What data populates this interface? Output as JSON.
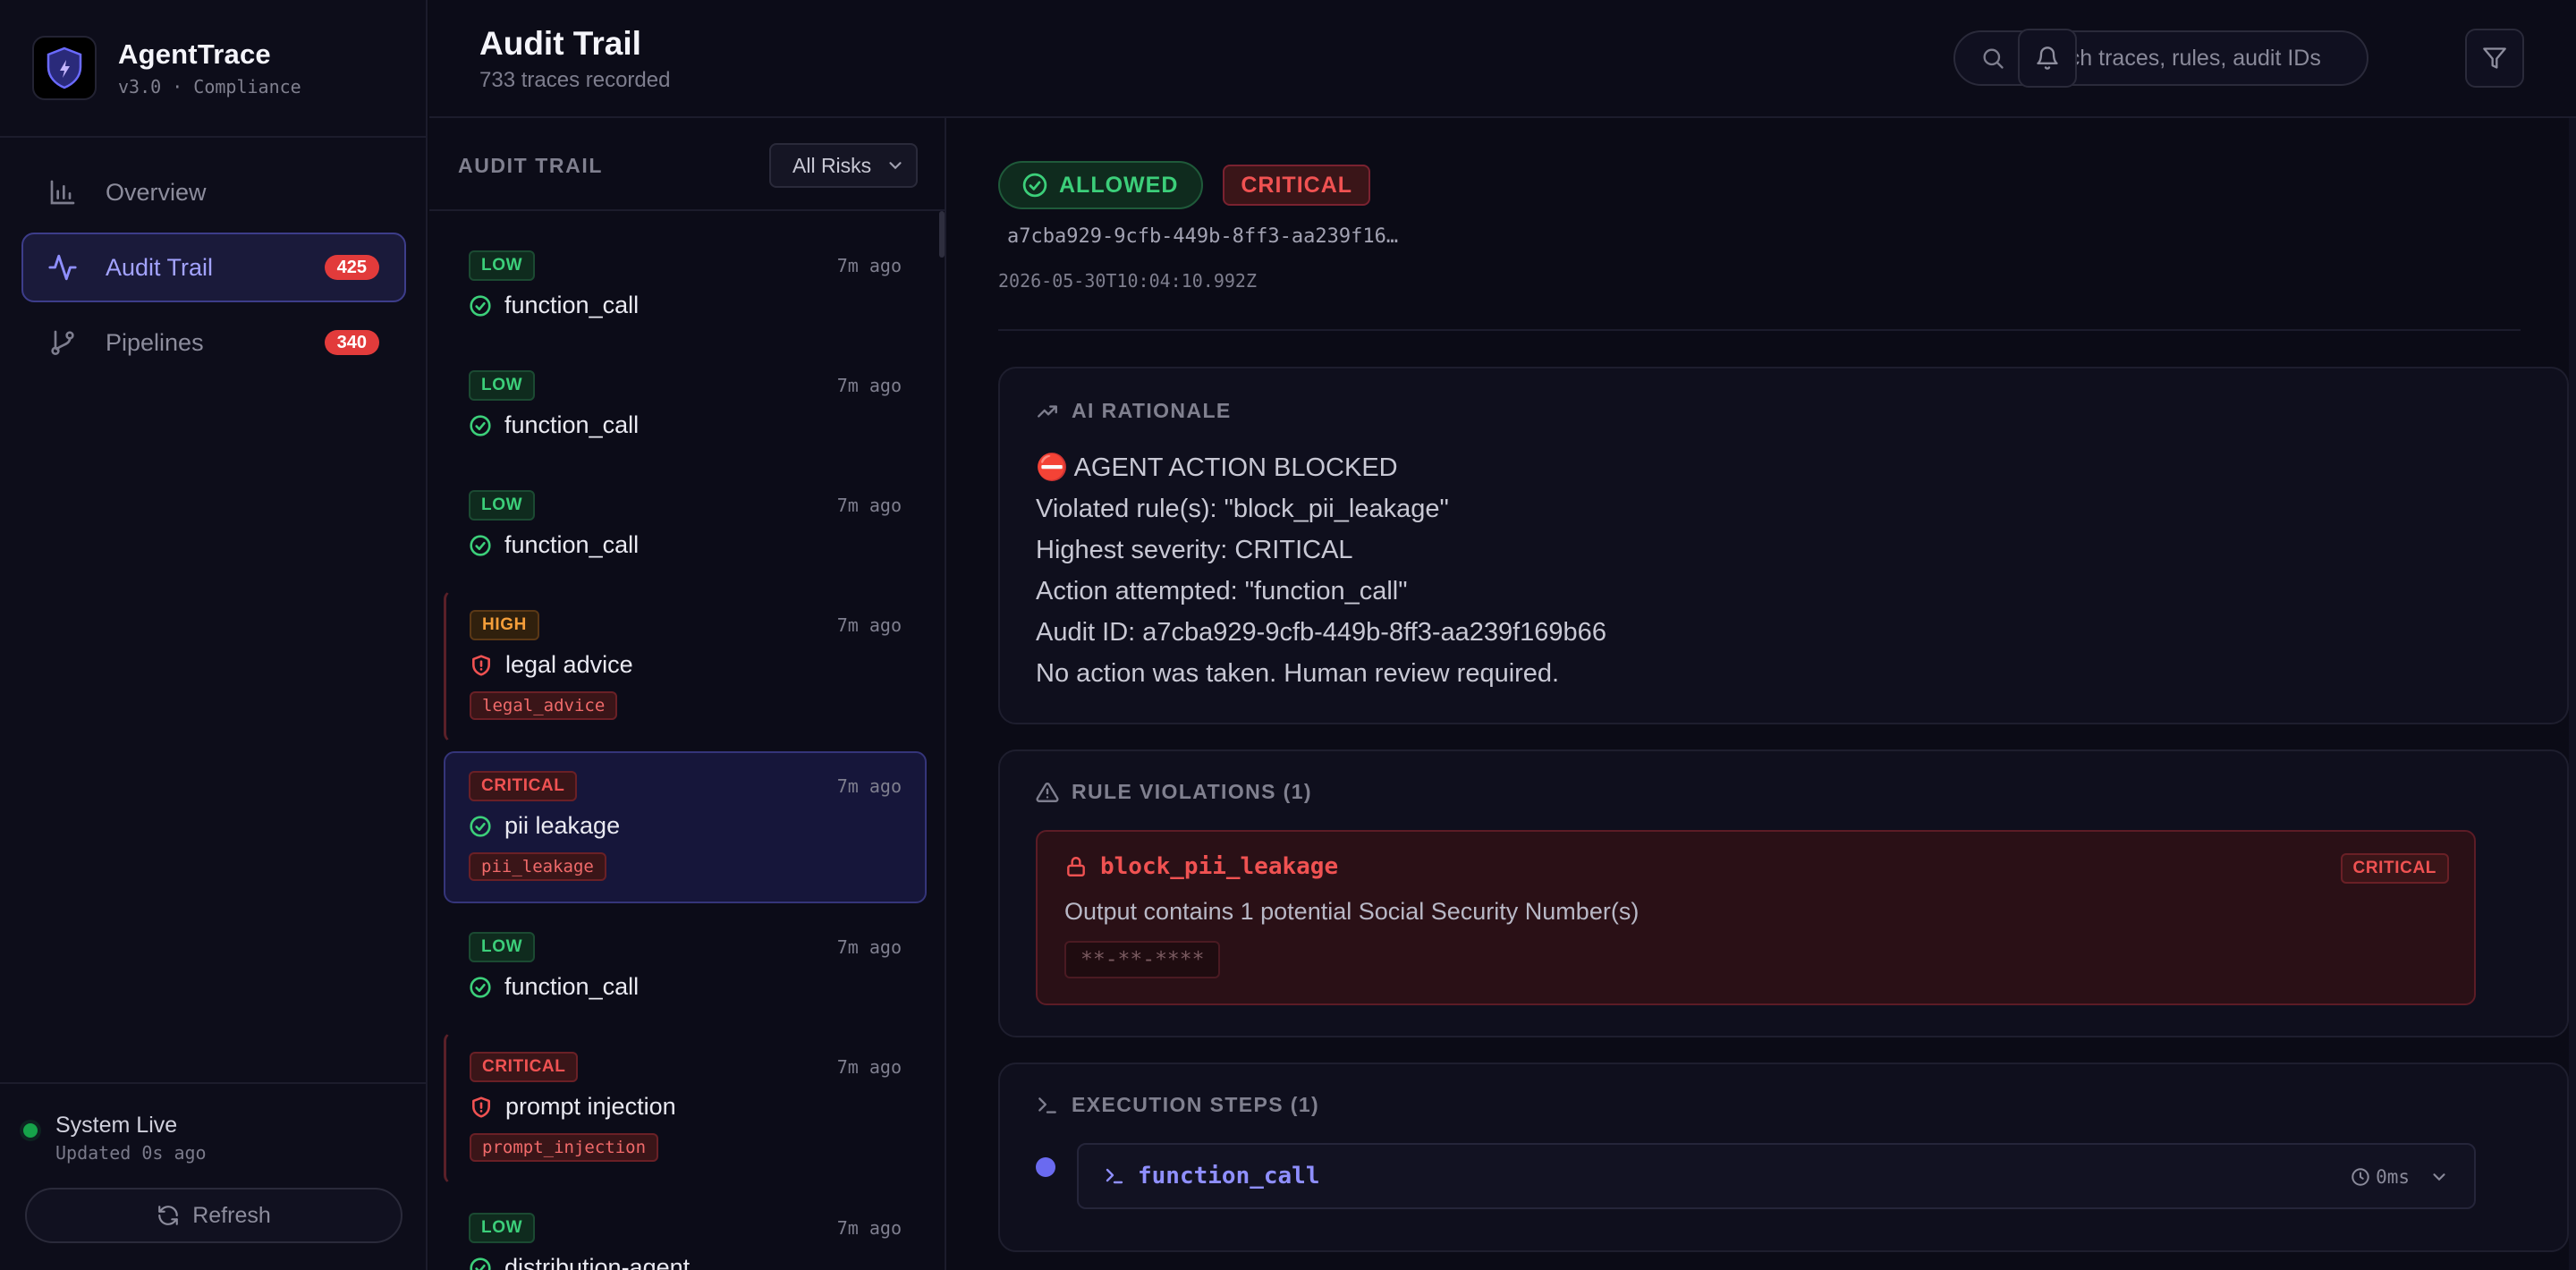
{
  "brand": {
    "name": "AgentTrace",
    "subtitle": "v3.0 · Compliance"
  },
  "nav": [
    {
      "label": "Overview",
      "icon": "bar-chart-icon",
      "badge": ""
    },
    {
      "label": "Audit Trail",
      "icon": "activity-icon",
      "badge": "425",
      "active": true
    },
    {
      "label": "Pipelines",
      "icon": "git-branch-icon",
      "badge": "340"
    }
  ],
  "system": {
    "title": "System Live",
    "updated": "Updated 0s ago",
    "refresh_label": "Refresh"
  },
  "header": {
    "title": "Audit Trail",
    "subtitle": "733 traces recorded",
    "search_placeholder": "Search traces, rules, audit IDs"
  },
  "list": {
    "title": "AUDIT TRAIL",
    "filter_value": "All Risks",
    "items": [
      {
        "risk": "LOW",
        "title": "function_call",
        "time": "7m ago",
        "status": "allowed",
        "tag": ""
      },
      {
        "risk": "LOW",
        "title": "function_call",
        "time": "7m ago",
        "status": "allowed",
        "tag": ""
      },
      {
        "risk": "LOW",
        "title": "function_call",
        "time": "7m ago",
        "status": "allowed",
        "tag": ""
      },
      {
        "risk": "HIGH",
        "title": "legal advice",
        "time": "7m ago",
        "status": "blocked",
        "tag": "legal_advice"
      },
      {
        "risk": "CRITICAL",
        "title": "pii leakage",
        "time": "7m ago",
        "status": "allowed",
        "tag": "pii_leakage",
        "selected": true
      },
      {
        "risk": "LOW",
        "title": "function_call",
        "time": "7m ago",
        "status": "allowed",
        "tag": ""
      },
      {
        "risk": "CRITICAL",
        "title": "prompt injection",
        "time": "7m ago",
        "status": "blocked",
        "tag": "prompt_injection"
      },
      {
        "risk": "LOW",
        "title": "distribution-agent",
        "time": "7m ago",
        "status": "allowed",
        "tag": ""
      }
    ]
  },
  "detail": {
    "status": "ALLOWED",
    "severity": "CRITICAL",
    "trace_id": "a7cba929-9cfb-449b-8ff3-aa239f16…",
    "timestamp": "2026-05-30T10:04:10.992Z",
    "rationale": {
      "title": "AI RATIONALE",
      "lines": [
        "⛔ AGENT ACTION BLOCKED",
        "Violated rule(s): \"block_pii_leakage\"",
        "Highest severity: CRITICAL",
        "Action attempted: \"function_call\"",
        "Audit ID: a7cba929-9cfb-449b-8ff3-aa239f169b66",
        "No action was taken. Human review required."
      ]
    },
    "violations": {
      "title": "RULE VIOLATIONS (1)",
      "items": [
        {
          "rule": "block_pii_leakage",
          "severity": "CRITICAL",
          "description": "Output contains 1 potential Social Security Number(s)",
          "redacted": "*‌*-**-****"
        }
      ]
    },
    "steps": {
      "title": "EXECUTION STEPS (1)",
      "items": [
        {
          "name": "function_call",
          "duration": "0ms"
        }
      ]
    }
  },
  "colors": {
    "accent": "#8f8fff",
    "success": "#3ccf7a",
    "danger": "#f05252",
    "warning": "#f59e3a",
    "background": "#0b0b16"
  }
}
